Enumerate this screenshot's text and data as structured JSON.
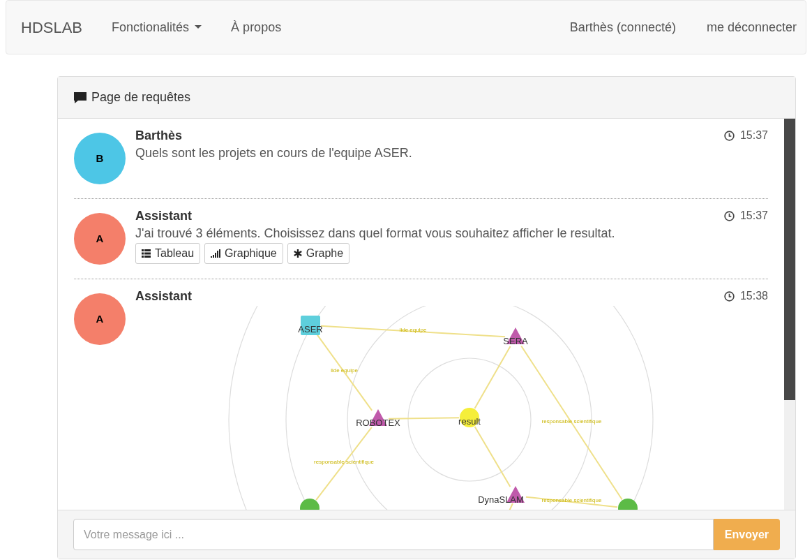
{
  "navbar": {
    "brand": "HDSLAB",
    "menu": [
      {
        "label": "Fonctionalités",
        "kind": "dropdown"
      },
      {
        "label": "À propos",
        "kind": "link"
      }
    ],
    "user": "Barthès (connecté)",
    "logout": "me déconnecter"
  },
  "panel": {
    "title": "Page de requêtes"
  },
  "messages": [
    {
      "author": "Barthès",
      "initial": "B",
      "color": "#4dc6e6",
      "time": "15:37",
      "text": "Quels sont les projets en cours de l'equipe ASER.",
      "kind": "text"
    },
    {
      "author": "Assistant",
      "initial": "A",
      "color": "#f47f6a",
      "time": "15:37",
      "text": "J'ai trouvé 3 éléments. Choisissez dans quel format vous souhaitez afficher le resultat.",
      "kind": "choices",
      "choices": [
        {
          "label": "Tableau",
          "kind": "table"
        },
        {
          "label": "Graphique",
          "kind": "chart"
        },
        {
          "label": "Graphe",
          "kind": "graph"
        }
      ]
    },
    {
      "author": "Assistant",
      "initial": "A",
      "color": "#f47f6a",
      "time": "15:38",
      "kind": "graph",
      "graph": {
        "nodes": [
          {
            "label": "ASER",
            "kind": "square",
            "color": "#5ecfdc"
          },
          {
            "label": "SERA",
            "kind": "triangle",
            "color": "#c05aab"
          },
          {
            "label": "ROBOTEX",
            "kind": "triangle",
            "color": "#c05aab"
          },
          {
            "label": "result",
            "kind": "circle",
            "color": "#f5ee3a"
          },
          {
            "label": "DynaSLAM",
            "kind": "triangle",
            "color": "#c05aab"
          },
          {
            "kind": "circle",
            "color": "#5cbb46"
          },
          {
            "kind": "circle",
            "color": "#5cbb46"
          }
        ],
        "edge_labels": [
          "lide equipe",
          "lide equipe",
          "responsable scientifique",
          "responsable scientifique",
          "responsable scientifique"
        ]
      }
    }
  ],
  "composer": {
    "placeholder": "Votre message ici ...",
    "send": "Envoyer"
  }
}
